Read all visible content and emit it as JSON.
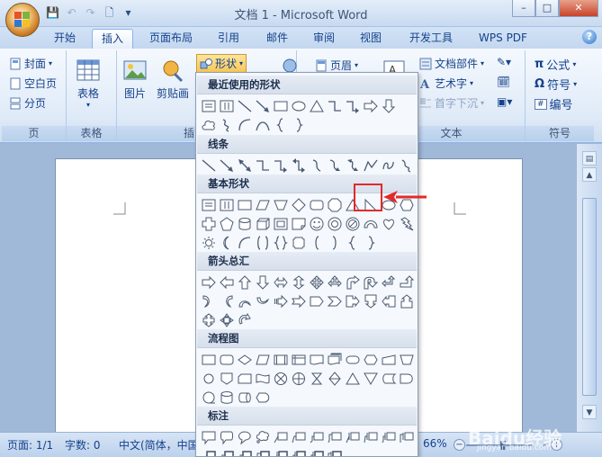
{
  "window": {
    "title": "文档 1 - Microsoft Word",
    "controls": [
      "–",
      "□",
      "✕"
    ]
  },
  "tabs": [
    "开始",
    "插入",
    "页面布局",
    "引用",
    "邮件",
    "审阅",
    "视图",
    "开发工具",
    "WPS PDF"
  ],
  "active_tab": "插入",
  "ribbon": {
    "pages_group": {
      "label": "页",
      "items": [
        "封面",
        "空白页",
        "分页"
      ]
    },
    "table_group": {
      "label": "表格",
      "button": "表格"
    },
    "illustrations_group": {
      "label": "插图",
      "picture": "图片",
      "clipart": "剪贴画",
      "shapes": "形状",
      "smartart": ""
    },
    "header_button": "页眉",
    "text_group": {
      "label": "文本",
      "items": [
        "文档部件",
        "艺术字",
        "首字下沉"
      ]
    },
    "symbols_group": {
      "label": "符号",
      "items": [
        "公式",
        "符号",
        "编号"
      ]
    }
  },
  "shapes_panel": {
    "categories": [
      {
        "name": "最近使用的形状",
        "rows": [
          [
            "text-box",
            "vertical-text",
            "line",
            "arrow-line",
            "rect",
            "oval",
            "triangle",
            "elbow",
            "elbow-arrow",
            "right-arrow",
            "down-arrow"
          ],
          [
            "cloud",
            "squiggle",
            "arc",
            "curve",
            "lbrace",
            "rbrace"
          ]
        ]
      },
      {
        "name": "线条",
        "rows": [
          [
            "line",
            "arrow-line",
            "double-arrow",
            "elbow",
            "elbow-arrow",
            "elbow-double",
            "curve-s",
            "curve-arrow",
            "curve-double",
            "freeform",
            "scribble",
            "freehand"
          ]
        ]
      },
      {
        "name": "基本形状",
        "rows": [
          [
            "text-box",
            "vertical-text",
            "rect",
            "parallelogram",
            "trapezoid",
            "diamond",
            "round-rect",
            "octagon",
            "triangle",
            "right-triangle",
            "oval",
            "hexagon"
          ],
          [
            "cross",
            "pentagon",
            "can",
            "cube",
            "bevel",
            "fold",
            "smiley",
            "donut",
            "no-symbol",
            "block-arc",
            "heart",
            "lightning"
          ],
          [
            "sun",
            "moon",
            "arc",
            "bracket-pair",
            "brace-pair",
            "plaque",
            "lbracket",
            "rbracket",
            "lbrace",
            "rbrace"
          ]
        ]
      },
      {
        "name": "箭头总汇",
        "rows": [
          [
            "right-arrow",
            "left-arrow",
            "up-arrow",
            "down-arrow",
            "lr-arrow",
            "ud-arrow",
            "quad-arrow",
            "lru-arrow",
            "bent-arrow",
            "uturn-arrow",
            "lu-arrow",
            "bent-up-arrow"
          ],
          [
            "curved-right",
            "curved-left",
            "curved-up",
            "curved-down",
            "striped-arrow",
            "notched-arrow",
            "pentagon-arrow",
            "chevron",
            "right-callout",
            "down-callout",
            "left-callout",
            "up-callout"
          ],
          [
            "ud-callout",
            "quad-callout",
            "circular-arrow"
          ]
        ]
      },
      {
        "name": "流程图",
        "rows": [
          [
            "process",
            "alt-process",
            "decision",
            "data",
            "predefined",
            "internal-storage",
            "document",
            "multidoc",
            "terminator",
            "preparation",
            "manual-input",
            "manual-op"
          ],
          [
            "connector",
            "offpage",
            "card",
            "punched-tape",
            "summing",
            "or",
            "collate",
            "sort",
            "extract",
            "merge",
            "stored-data",
            "delay"
          ],
          [
            "seq-access",
            "magnetic-disk",
            "direct-access",
            "display"
          ]
        ]
      },
      {
        "name": "标注",
        "rows": [
          [
            "rect-callout",
            "round-callout",
            "oval-callout",
            "cloud-callout",
            "line-callout1",
            "line-callout2",
            "line-callout3",
            "line-callout4",
            "accent-callout1",
            "accent-callout2",
            "accent-callout3",
            "accent-callout4"
          ],
          [
            "border-callout1",
            "border-callout2",
            "border-callout3",
            "border-callout4",
            "ab-callout1",
            "ab-callout2",
            "ab-callout3",
            "ab-callout4"
          ]
        ]
      }
    ],
    "highlighted_shape": "right-triangle"
  },
  "statusbar": {
    "page": "页面: 1/1",
    "words": "字数: 0",
    "language": "中文(简体，中国",
    "zoom": "66%",
    "watermark": "Baidu经验",
    "watermark_url": "jingyan.baidu.com"
  },
  "colors": {
    "accent": "#15428b",
    "highlight": "#e12a2a"
  },
  "zoom_level": 66
}
